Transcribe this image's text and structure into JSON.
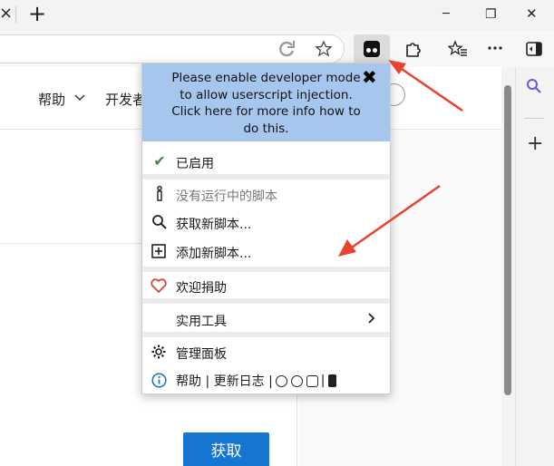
{
  "tabbar": {
    "close_glyph": "×",
    "new_tab_glyph": "+",
    "minimize_glyph": "─",
    "restore_glyph": "❐",
    "close_window_glyph": "✕"
  },
  "toolbar": {
    "icons": [
      "refresh-icon",
      "favorite-star-icon",
      "tampermonkey-icon",
      "extensions-icon",
      "favorites-icon",
      "more-icon",
      "sidebar-icon"
    ]
  },
  "page": {
    "nav": [
      {
        "label": "帮助",
        "has_chevron": true
      },
      {
        "label": "开发者",
        "clipped": true
      }
    ],
    "get_button": "获取"
  },
  "popup": {
    "notice": "Please enable developer mode to allow userscript injection. Click here for more info how to do this.",
    "close": "✖",
    "items": {
      "enabled": "已启用",
      "no_scripts": "没有运行中的脚本",
      "get_new": "获取新脚本...",
      "add_new": "添加新脚本...",
      "donate": "欢迎捐助",
      "utilities": "实用工具",
      "dashboard": "管理面板"
    },
    "footer": "帮助 | 更新日志 |"
  },
  "sidebar": {
    "search_glyph": "🔍",
    "add_glyph": "+"
  },
  "colors": {
    "accent_blue": "#1677d2",
    "notice_bg": "#a7c6ee",
    "arrow_red": "#e8432e",
    "check_green": "#3a8a3a"
  }
}
